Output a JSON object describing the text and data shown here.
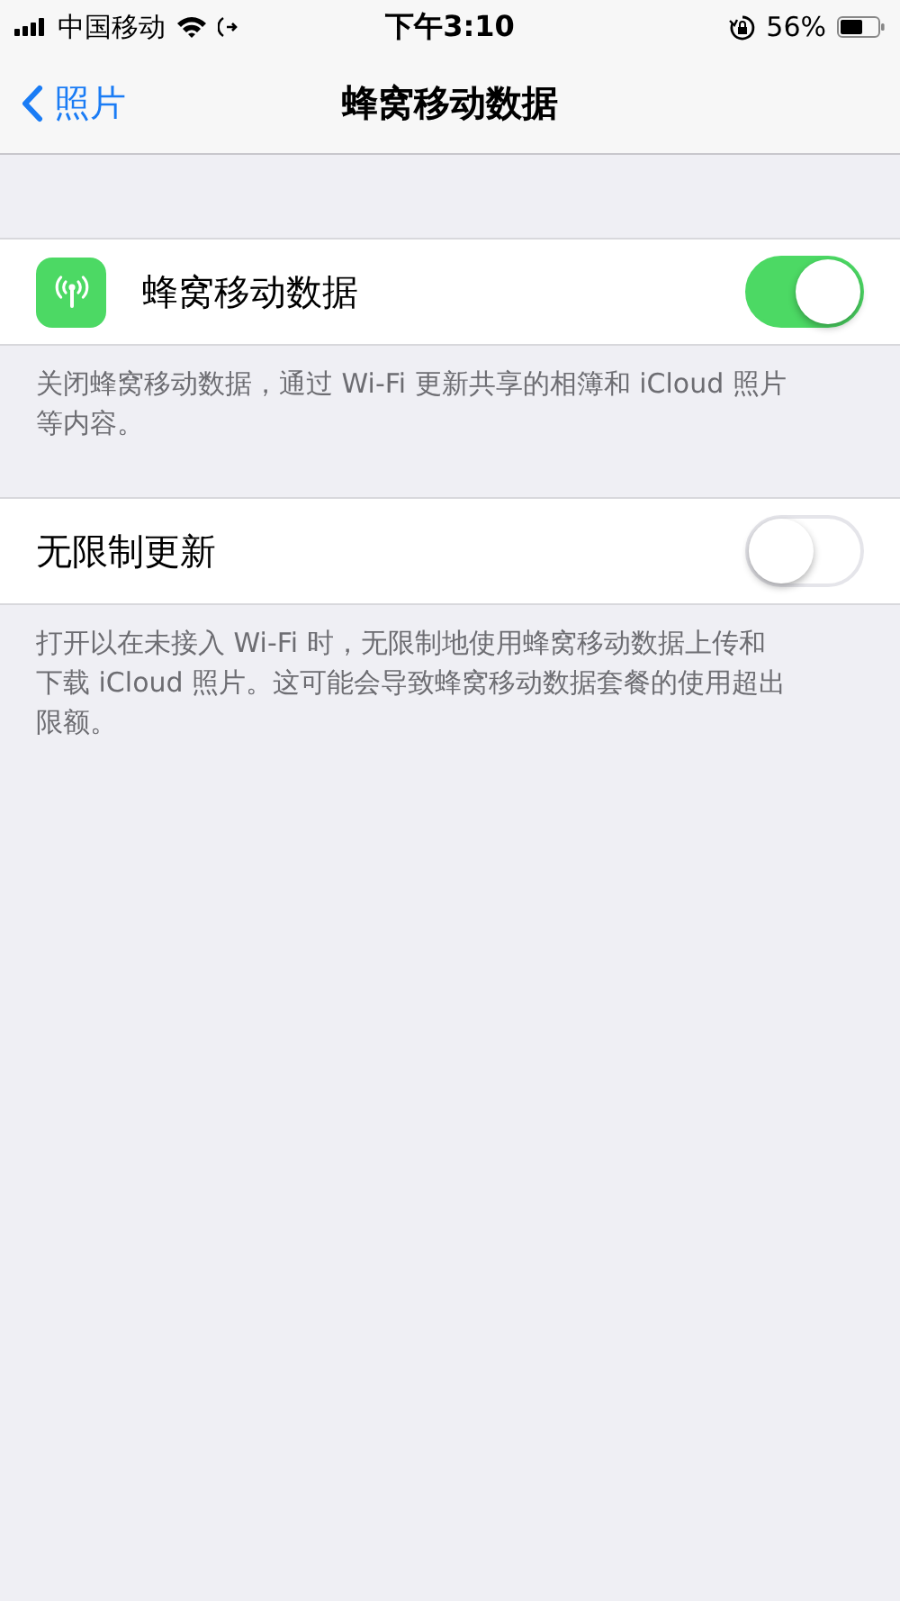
{
  "status_bar": {
    "carrier": "中国移动",
    "time": "下午3:10",
    "battery": "56%"
  },
  "nav": {
    "back": "照片",
    "title": "蜂窝移动数据"
  },
  "sections": [
    {
      "rows": [
        {
          "kind": "icon_switch",
          "label": "蜂窝移动数据",
          "on": true
        }
      ],
      "footer": "关闭蜂窝移动数据，通过 Wi-Fi 更新共享的相簿和 iCloud 照片等内容。"
    },
    {
      "rows": [
        {
          "kind": "switch",
          "label": "无限制更新",
          "on": false
        }
      ],
      "footer": "打开以在未接入 Wi-Fi 时，无限制地使用蜂窝移动数据上传和下载 iCloud 照片。这可能会导致蜂窝移动数据套餐的使用超出限额。"
    }
  ]
}
